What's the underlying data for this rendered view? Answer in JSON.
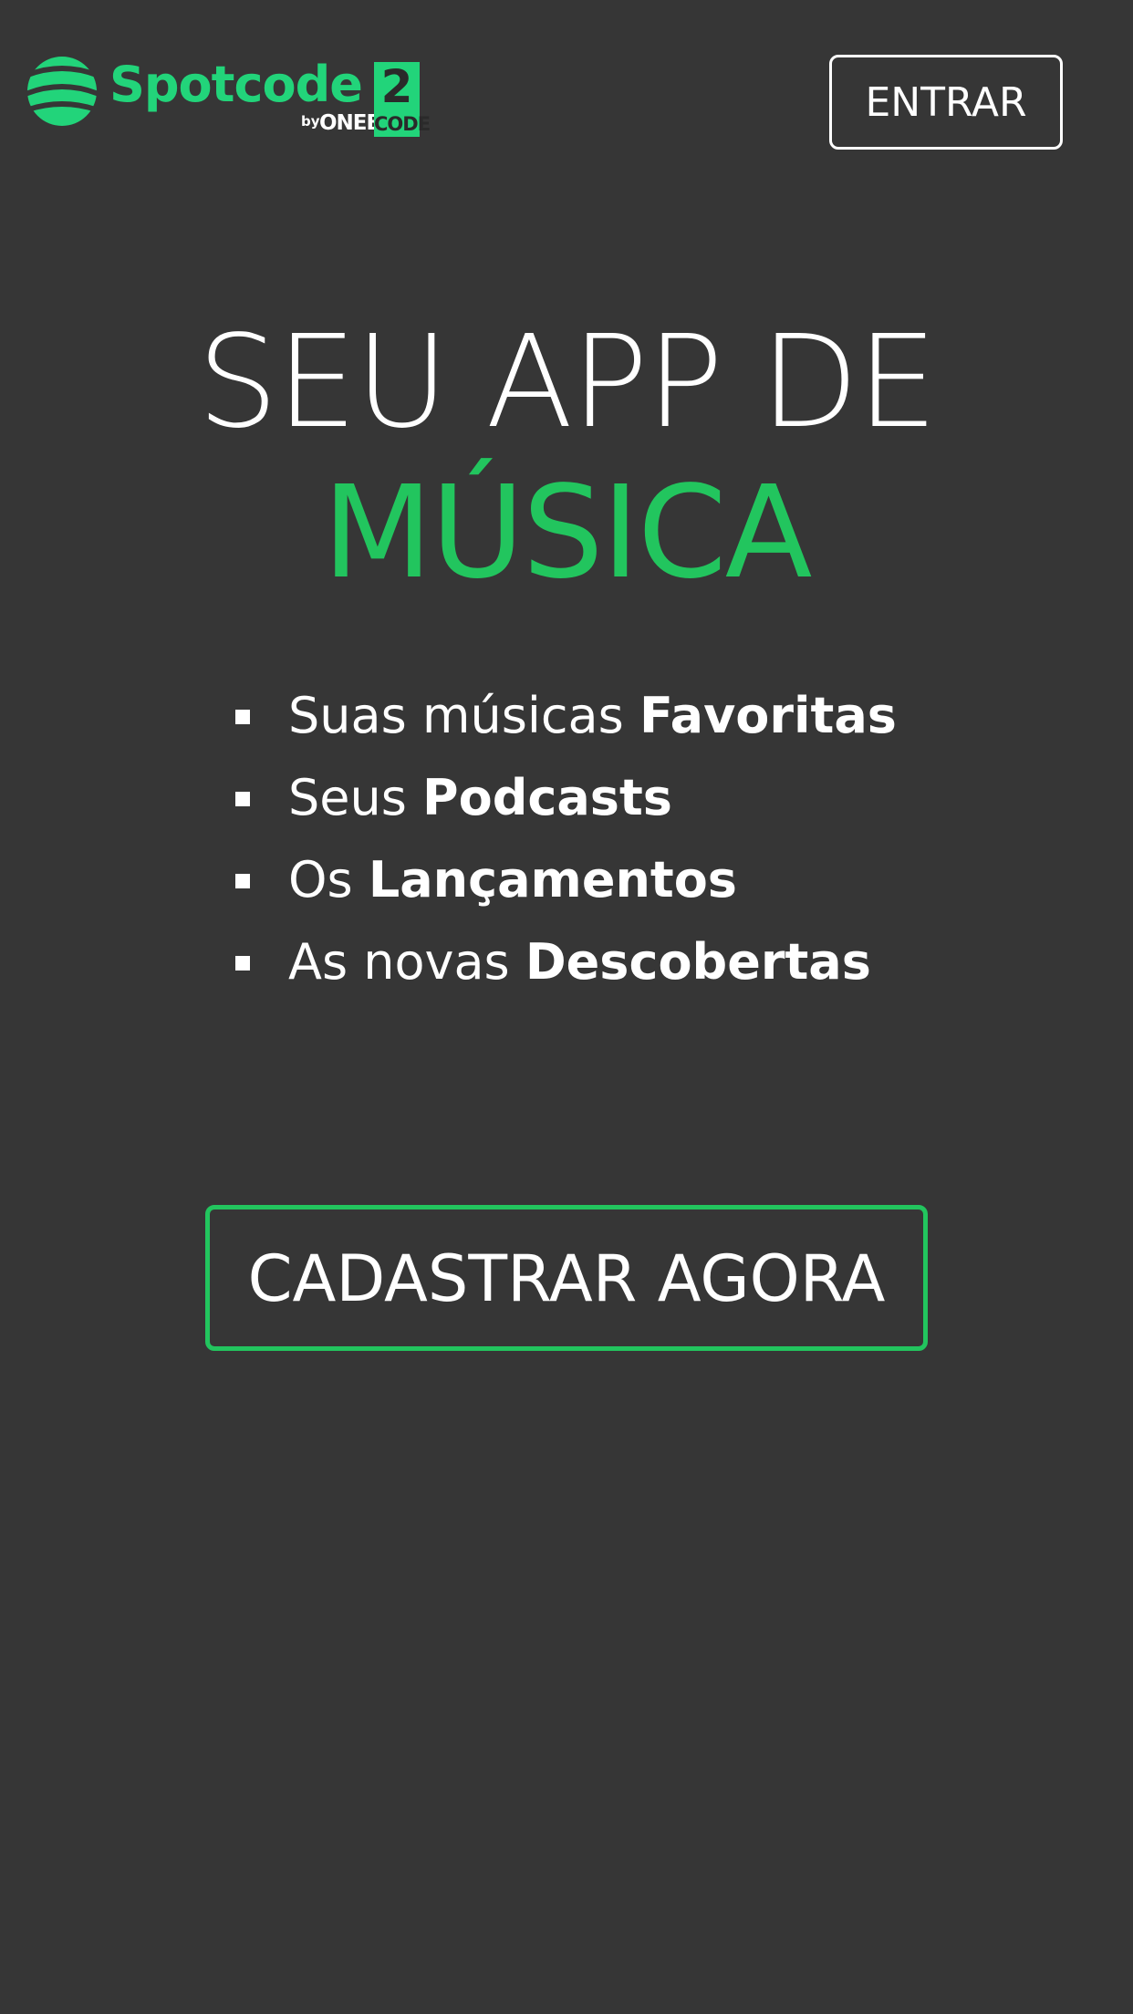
{
  "header": {
    "logo": {
      "wordmark": "Spotcode",
      "number": "2",
      "by": "by",
      "onebit": "ONEBIT",
      "code": "CODE"
    },
    "login_label": "ENTRAR"
  },
  "hero": {
    "line1": "SEU APP DE",
    "line2": "MÚSICA"
  },
  "features": [
    {
      "text": "Suas músicas ",
      "bold": "Favoritas"
    },
    {
      "text": "Seus ",
      "bold": "Podcasts"
    },
    {
      "text": "Os ",
      "bold": "Lançamentos"
    },
    {
      "text": "As novas ",
      "bold": "Descobertas"
    }
  ],
  "cta_label": "CADASTRAR AGORA",
  "colors": {
    "background": "#363636",
    "accent": "#22c55e",
    "logo_green": "#22d47a",
    "text": "#ffffff"
  },
  "icons": {
    "logo_mark": "soundwave-sphere-icon",
    "bullet": "square-bullet-icon"
  }
}
